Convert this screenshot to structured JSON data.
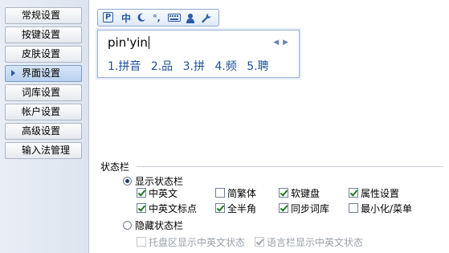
{
  "sidebar": {
    "items": [
      {
        "label": "常规设置",
        "active": false
      },
      {
        "label": "按键设置",
        "active": false
      },
      {
        "label": "皮肤设置",
        "active": false
      },
      {
        "label": "界面设置",
        "active": true
      },
      {
        "label": "词库设置",
        "active": false
      },
      {
        "label": "帐户设置",
        "active": false
      },
      {
        "label": "高级设置",
        "active": false
      },
      {
        "label": "输入法管理",
        "active": false
      }
    ]
  },
  "preview": {
    "toolbar": {
      "logo": "P",
      "lang": "中",
      "punct": "°,",
      "icons": [
        "logo-icon",
        "chinese-mode-icon",
        "moon-icon",
        "punctuation-icon",
        "keyboard-icon",
        "user-icon",
        "wrench-icon"
      ]
    },
    "composition": "pin'yin",
    "pager": "◀ ▶",
    "candidates": [
      "1.拼音",
      "2.品",
      "3.拼",
      "4.频",
      "5.聘"
    ]
  },
  "status": {
    "title": "状态栏",
    "show_radio": {
      "label": "显示状态栏",
      "selected": true
    },
    "hide_radio": {
      "label": "隐藏状态栏",
      "selected": false
    },
    "options_row1": [
      {
        "label": "中英文",
        "checked": true
      },
      {
        "label": "简繁体",
        "checked": false
      },
      {
        "label": "软键盘",
        "checked": true
      },
      {
        "label": "属性设置",
        "checked": true
      }
    ],
    "options_row2": [
      {
        "label": "中英文标点",
        "checked": true
      },
      {
        "label": "全半角",
        "checked": true
      },
      {
        "label": "同步词库",
        "checked": true
      },
      {
        "label": "最小化/菜单",
        "checked": false
      }
    ],
    "hidden_options": [
      {
        "label": "托盘区显示中英文状态",
        "checked": false,
        "disabled": true
      },
      {
        "label": "语言栏显示中英文状态",
        "checked": true,
        "disabled": true
      }
    ]
  },
  "colors": {
    "accent": "#2a5aa6",
    "check": "#1a7a22",
    "candidate": "#1e4f9a"
  }
}
